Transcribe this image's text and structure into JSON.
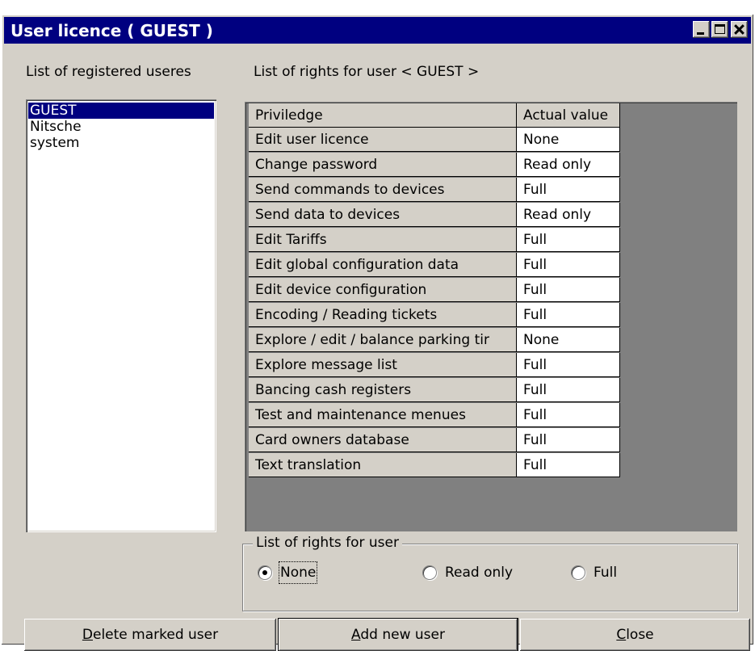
{
  "window": {
    "title": "User licence ( GUEST )"
  },
  "users": {
    "label": "List of registered useres",
    "items": [
      "GUEST",
      "Nitsche",
      "system"
    ],
    "selected": "GUEST"
  },
  "rights": {
    "label": "List of rights for user < GUEST >",
    "columns": [
      "Priviledge",
      "Actual value"
    ],
    "rows": [
      [
        "Edit user licence",
        "None"
      ],
      [
        "Change password",
        "Read only"
      ],
      [
        "Send commands to devices",
        "Full"
      ],
      [
        "Send data to devices",
        "Read only"
      ],
      [
        "Edit Tariffs",
        "Full"
      ],
      [
        "Edit global configuration data",
        "Full"
      ],
      [
        "Edit device configuration",
        "Full"
      ],
      [
        "Encoding / Reading tickets",
        "Full"
      ],
      [
        "Explore / edit / balance parking tir",
        "None"
      ],
      [
        "Explore message list",
        "Full"
      ],
      [
        "Bancing cash registers",
        "Full"
      ],
      [
        "Test and maintenance menues",
        "Full"
      ],
      [
        "Card owners database",
        "Full"
      ],
      [
        "Text translation",
        "Full"
      ]
    ]
  },
  "radio_group": {
    "legend": "List of rights for user",
    "options": [
      "None",
      "Read only",
      "Full"
    ],
    "selected": "None"
  },
  "buttons": {
    "delete": {
      "hotkey": "D",
      "rest": "elete marked user"
    },
    "add": {
      "hotkey": "A",
      "rest": "dd new user"
    },
    "close": {
      "hotkey": "C",
      "rest": "lose"
    }
  }
}
